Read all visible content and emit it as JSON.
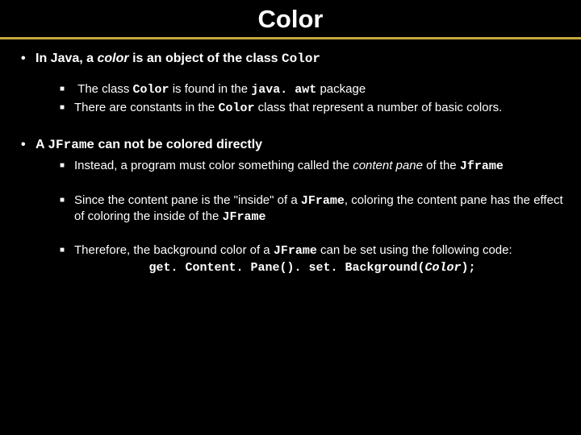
{
  "title": "Color",
  "p1": {
    "pre": "In Java, a ",
    "em": "color",
    "mid": " is an object of the class ",
    "code": "Color",
    "sub1": {
      "a": "The class ",
      "code1": "Color",
      "b": " is found in the ",
      "code2": "java. awt",
      "c": " package"
    },
    "sub2": {
      "a": "There are constants in the ",
      "code1": "Color",
      "b": " class that represent a number of basic colors."
    }
  },
  "p2": {
    "a": "A ",
    "code": "JFrame",
    "b": " can not be colored directly",
    "sub1": {
      "a": "Instead, a program must color something called the ",
      "em": "content pane",
      "b": " of the ",
      "code1": "Jframe"
    },
    "sub2": {
      "a": "Since the content pane is the \"inside\" of a ",
      "code1": "JFrame",
      "b": ", coloring the content pane has the effect of coloring the inside of the ",
      "code2": "JFrame"
    },
    "sub3": {
      "a": "Therefore, the background color of a ",
      "code1": "JFrame",
      "b": " can be set using the following code:"
    },
    "codeline": {
      "a": "get. Content. Pane(). set. Background(",
      "arg": "Color",
      "b": ");"
    }
  }
}
